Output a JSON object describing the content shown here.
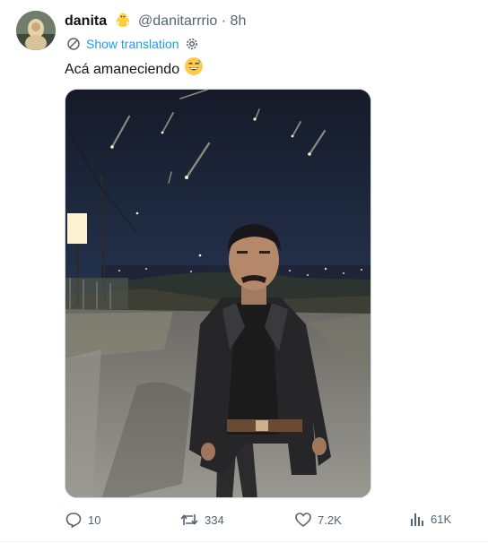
{
  "author": {
    "display_name": "danita",
    "badge_emoji": "chick-emoji",
    "handle": "@danitarrrio",
    "separator": "·",
    "time": "8h"
  },
  "translate": {
    "label": "Show translation",
    "icon": "translate-icon",
    "settings_icon": "gear-icon"
  },
  "tweet": {
    "text": "Acá amaneciendo",
    "emoji": "sweat-smile-emoji"
  },
  "media": {
    "description_icon": "photo"
  },
  "actions": {
    "replies": "10",
    "reposts": "334",
    "likes": "7.2K",
    "views": "61K"
  },
  "colors": {
    "link": "#1d9bf0",
    "muted": "#536471",
    "text": "#0f1419"
  }
}
